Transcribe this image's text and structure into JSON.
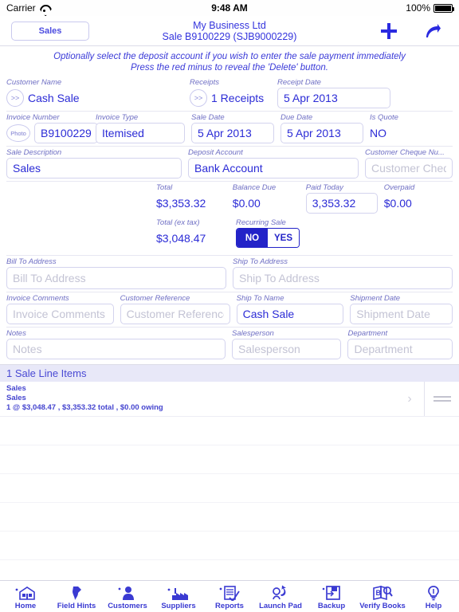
{
  "statusbar": {
    "carrier": "Carrier",
    "wifi_icon": "wifi-icon",
    "time": "9:48 AM",
    "battery_pct": "100%",
    "battery_icon": "battery-full-icon"
  },
  "navbar": {
    "back_label": "Sales",
    "title_line1": "My Business Ltd",
    "title_line2": "Sale B9100229 (SJB9000229)",
    "add_icon": "plus-icon",
    "share_icon": "forward-arrow-icon"
  },
  "instructions": {
    "line1": "Optionally select the deposit account if you wish to enter the sale payment immediately",
    "line2": "Press the red minus to reveal the 'Delete' button."
  },
  "form": {
    "customer_name": {
      "label": "Customer Name",
      "value": "Cash Sale",
      "chevron": ">>"
    },
    "receipts": {
      "label": "Receipts",
      "value": "1 Receipts",
      "chevron": ">>"
    },
    "receipt_date": {
      "label": "Receipt Date",
      "value": "5 Apr 2013"
    },
    "invoice_number": {
      "label": "Invoice Number",
      "value": "B9100229",
      "photo_label": "Photo"
    },
    "invoice_type": {
      "label": "Invoice Type",
      "value": "Itemised"
    },
    "sale_date": {
      "label": "Sale Date",
      "value": "5 Apr 2013"
    },
    "due_date": {
      "label": "Due Date",
      "value": "5 Apr 2013"
    },
    "is_quote": {
      "label": "Is Quote",
      "value": "NO"
    },
    "sale_description": {
      "label": "Sale Description",
      "value": "Sales"
    },
    "deposit_account": {
      "label": "Deposit Account",
      "value": "Bank Account"
    },
    "customer_cheque": {
      "label": "Customer Cheque Nu...",
      "placeholder": "Customer Cheq..."
    },
    "total": {
      "label": "Total",
      "value": "$3,353.32"
    },
    "balance_due": {
      "label": "Balance Due",
      "value": "$0.00"
    },
    "paid_today": {
      "label": "Paid Today",
      "value": "3,353.32"
    },
    "overpaid": {
      "label": "Overpaid",
      "value": "$0.00"
    },
    "total_ex_tax": {
      "label": "Total (ex tax)",
      "value": "$3,048.47"
    },
    "recurring_sale": {
      "label": "Recurring Sale",
      "option_no": "NO",
      "option_yes": "YES",
      "selected": "NO"
    },
    "bill_to_address": {
      "label": "Bill To Address",
      "placeholder": "Bill To Address"
    },
    "ship_to_address": {
      "label": "Ship To Address",
      "placeholder": "Ship To Address"
    },
    "invoice_comments": {
      "label": "Invoice Comments",
      "placeholder": "Invoice Comments"
    },
    "customer_reference": {
      "label": "Customer Reference",
      "placeholder": "Customer Reference"
    },
    "ship_to_name": {
      "label": "Ship To Name",
      "value": "Cash Sale"
    },
    "shipment_date": {
      "label": "Shipment Date",
      "placeholder": "Shipment Date"
    },
    "notes": {
      "label": "Notes",
      "placeholder": "Notes"
    },
    "salesperson": {
      "label": "Salesperson",
      "placeholder": "Salesperson"
    },
    "department": {
      "label": "Department",
      "placeholder": "Department"
    }
  },
  "line_items": {
    "header": "1 Sale Line Items",
    "rows": [
      {
        "line1": "Sales",
        "line2": "Sales",
        "line3": "1 @ $3,048.47 , $3,353.32 total , $0.00 owing",
        "chevron": "›",
        "grip_icon": "drag-handle-icon"
      }
    ]
  },
  "tabbar": {
    "items": [
      {
        "label": "Home",
        "icon": "house-icon"
      },
      {
        "label": "Field Hints",
        "icon": "pen-nib-icon"
      },
      {
        "label": "Customers",
        "icon": "person-icon"
      },
      {
        "label": "Suppliers",
        "icon": "factory-icon"
      },
      {
        "label": "Reports",
        "icon": "report-checklist-icon"
      },
      {
        "label": "Launch Pad",
        "icon": "rocket-swirl-icon"
      },
      {
        "label": "Backup",
        "icon": "floppy-disk-icon"
      },
      {
        "label": "Verify Books",
        "icon": "book-magnifier-icon"
      },
      {
        "label": "Help",
        "icon": "lightbulb-icon"
      }
    ]
  },
  "colors": {
    "accent_blue": "#2b2bd6",
    "label_blue": "#6f6fc4",
    "segment_selected": "#2323c8",
    "header_bg": "#e8e8f8"
  }
}
